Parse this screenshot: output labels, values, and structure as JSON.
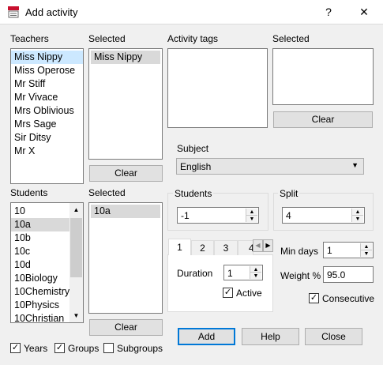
{
  "window": {
    "title": "Add activity",
    "help_glyph": "?",
    "close_glyph": "✕"
  },
  "teachers": {
    "label": "Teachers",
    "items": [
      "Miss Nippy",
      "Miss Operose",
      "Mr Stiff",
      "Mr Vivace",
      "Mrs Oblivious",
      "Mrs Sage",
      "Sir Ditsy",
      "Mr X"
    ],
    "selected_label": "Selected",
    "selected_items": [
      "Miss Nippy"
    ],
    "clear_label": "Clear"
  },
  "students": {
    "label": "Students",
    "items": [
      "10",
      "10a",
      "10b",
      "10c",
      "10d",
      "10Biology",
      "10Chemistry",
      "10Physics",
      "10Christian"
    ],
    "selected_label": "Selected",
    "selected_items": [
      "10a"
    ],
    "clear_label": "Clear"
  },
  "activity_tags": {
    "label": "Activity tags",
    "selected_label": "Selected",
    "clear_label": "Clear"
  },
  "subject": {
    "label": "Subject",
    "value": "English"
  },
  "students_count": {
    "label": "Students",
    "value": "-1"
  },
  "split": {
    "label": "Split",
    "value": "4"
  },
  "tabs": {
    "items": [
      "1",
      "2",
      "3",
      "4"
    ]
  },
  "duration": {
    "label": "Duration",
    "value": "1"
  },
  "active": {
    "label": "Active",
    "checked": true
  },
  "min_days": {
    "label": "Min days",
    "value": "1"
  },
  "weight": {
    "label": "Weight %",
    "value": "95.0"
  },
  "consecutive": {
    "label": "Consecutive",
    "checked": true
  },
  "filters": {
    "years": {
      "label": "Years",
      "checked": true
    },
    "groups": {
      "label": "Groups",
      "checked": true
    },
    "subgroups": {
      "label": "Subgroups",
      "checked": false
    }
  },
  "buttons": {
    "add": "Add",
    "help": "Help",
    "close": "Close"
  }
}
